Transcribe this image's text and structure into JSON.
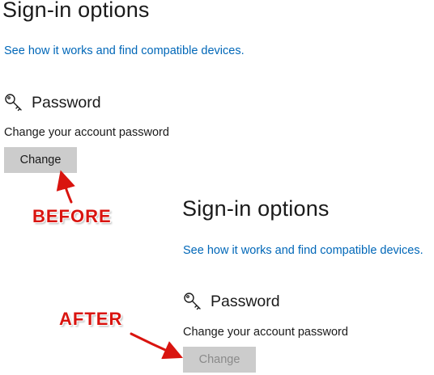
{
  "before": {
    "title": "Sign-in options",
    "link": "See how it works and find compatible devices.",
    "section_title": "Password",
    "section_icon": "key-icon",
    "description": "Change your account password",
    "button_label": "Change",
    "button_state": "enabled"
  },
  "after": {
    "title": "Sign-in options",
    "link": "See how it works and find compatible devices.",
    "section_title": "Password",
    "section_icon": "key-icon",
    "description": "Change your account password",
    "button_label": "Change",
    "button_state": "disabled"
  },
  "annotations": {
    "before_label": "BEFORE",
    "after_label": "AFTER",
    "color": "#d9140f"
  },
  "colors": {
    "link": "#0067b8",
    "button_bg": "#cccccc",
    "disabled_text": "#8a8a8a"
  }
}
